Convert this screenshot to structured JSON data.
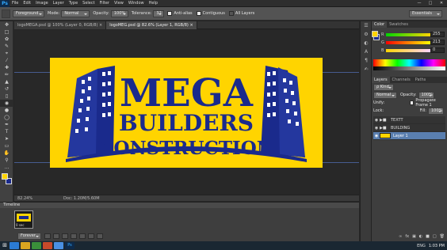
{
  "menu": {
    "app_icon": "Ps",
    "items": [
      "File",
      "Edit",
      "Image",
      "Layer",
      "Type",
      "Select",
      "Filter",
      "View",
      "Window",
      "Help"
    ],
    "window_controls": [
      "—",
      "□",
      "✕"
    ]
  },
  "options": {
    "preset": "Foreground",
    "mode_label": "Mode:",
    "mode_value": "Normal",
    "opacity_label": "Opacity:",
    "opacity_value": "100%",
    "tolerance_label": "Tolerance:",
    "tolerance_value": "32",
    "antialias_label": "Anti-alias",
    "contiguous_label": "Contiguous",
    "alllayers_label": "All Layers",
    "workspace": "Essentials"
  },
  "tabs": [
    {
      "label": "logoMEGA.psd @ 100% (Layer 0, RGB/8)",
      "active": false
    },
    {
      "label": "logoMEG.psd @ 82.6% (Layer 1, RGB/8)",
      "active": true
    }
  ],
  "logo": {
    "line1": "MEGA",
    "line2": "BUILDERS",
    "line3": "CONSTRUCTION",
    "bg_color": "#ffd400",
    "ink_color": "#1a2a8c"
  },
  "status": {
    "zoom": "82.24%",
    "doc": "Doc: 1.20M/5.60M"
  },
  "timeline": {
    "title": "Timeline",
    "clip_label": "0 sec",
    "mode": "Forever"
  },
  "color_panel": {
    "tabs": [
      "Color",
      "Swatches"
    ],
    "channels": [
      {
        "label": "R",
        "value": "255"
      },
      {
        "label": "G",
        "value": "213"
      },
      {
        "label": "B",
        "value": "0"
      }
    ],
    "foreground": "#ffd400",
    "background": "#1a2a8c"
  },
  "layers_panel": {
    "tabs": [
      "Layers",
      "Channels",
      "Paths"
    ],
    "filter_label": "ρ Kind",
    "blend_mode": "Normal",
    "opacity_label": "Opacity:",
    "opacity_value": "100%",
    "unify_label": "Unify:",
    "propagate_label": "Propagate Frame 1",
    "lock_label": "Lock:",
    "fill_label": "Fill:",
    "fill_value": "100%",
    "layers": [
      {
        "name": "TEXTT",
        "type": "group",
        "selected": false
      },
      {
        "name": "BUILDING",
        "type": "group",
        "selected": false
      },
      {
        "name": "Layer 1",
        "type": "layer",
        "selected": true
      }
    ]
  },
  "taskbar": {
    "start": "⊞",
    "lang": "ENG",
    "time": "1:03 PM"
  }
}
